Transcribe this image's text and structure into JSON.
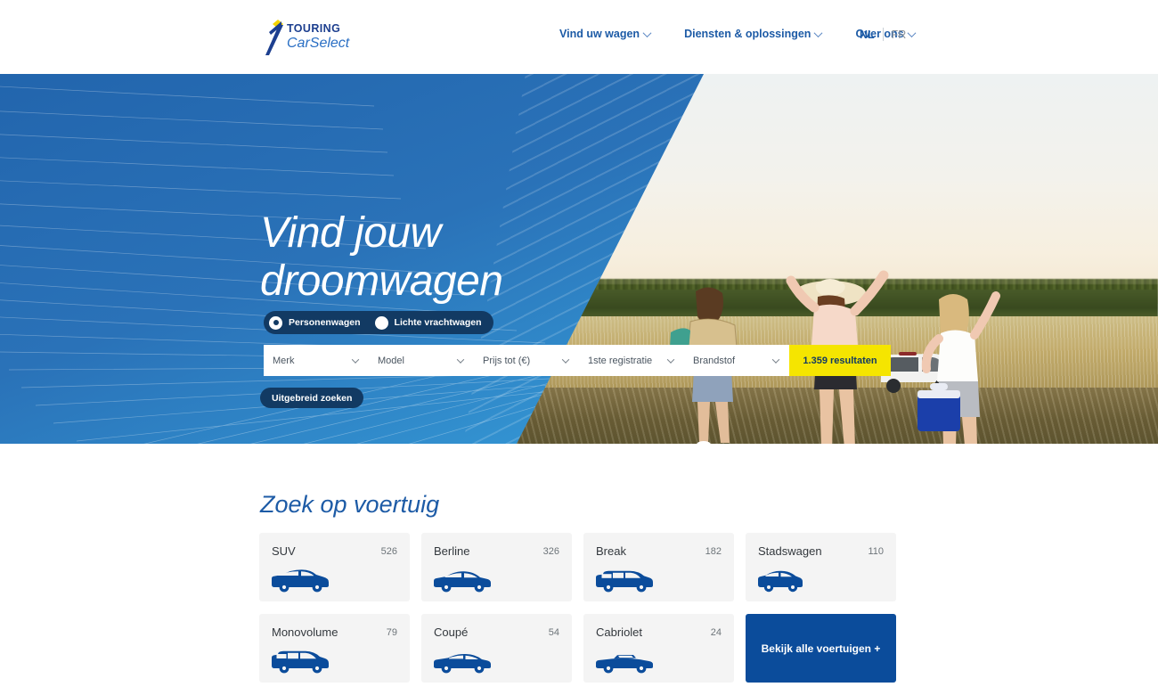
{
  "header": {
    "logo_top": "TOURING",
    "logo_bottom": "CarSelect",
    "nav": [
      {
        "label": "Vind uw wagen",
        "has_caret": true
      },
      {
        "label": "Diensten & oplossingen",
        "has_caret": true
      },
      {
        "label": "Over ons",
        "has_caret": true
      }
    ],
    "lang_active": "NL",
    "lang_inactive": "FR"
  },
  "hero": {
    "title": "Vind jouw\ndroomwagen",
    "vehicle_type": {
      "options": [
        {
          "label": "Personenwagen",
          "selected": true
        },
        {
          "label": "Lichte vrachtwagen",
          "selected": false
        }
      ]
    },
    "filters": [
      {
        "label": "Merk"
      },
      {
        "label": "Model"
      },
      {
        "label": "Prijs tot (€)"
      },
      {
        "label": "1ste registratie"
      },
      {
        "label": "Brandstof"
      }
    ],
    "results_button": "1.359 resultaten",
    "advanced_button": "Uitgebreid zoeken"
  },
  "vehicle_section": {
    "title": "Zoek op voertuig",
    "cards": [
      {
        "name": "SUV",
        "count": "526",
        "icon": "suv-icon"
      },
      {
        "name": "Berline",
        "count": "326",
        "icon": "sedan-icon"
      },
      {
        "name": "Break",
        "count": "182",
        "icon": "wagon-icon"
      },
      {
        "name": "Stadswagen",
        "count": "110",
        "icon": "hatchback-icon"
      },
      {
        "name": "Monovolume",
        "count": "79",
        "icon": "minivan-icon"
      },
      {
        "name": "Coupé",
        "count": "54",
        "icon": "coupe-icon"
      },
      {
        "name": "Cabriolet",
        "count": "24",
        "icon": "convertible-icon"
      }
    ],
    "cta": "Bekijk alle voertuigen +"
  },
  "colors": {
    "brand_blue": "#1d5ba6",
    "deep_navy": "#123a63",
    "accent_yellow": "#f5e500",
    "cta_blue": "#0b4c9b",
    "card_bg": "#f4f4f4"
  }
}
